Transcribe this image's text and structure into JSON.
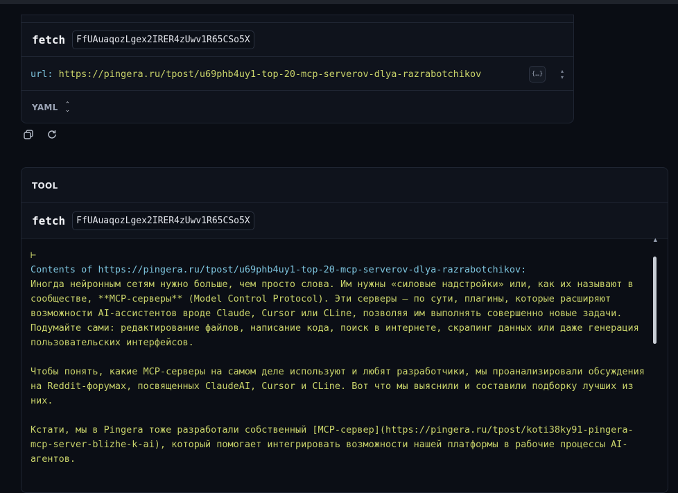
{
  "call": {
    "tool_name": "fetch",
    "call_id": "FfUAuaqozLgex2IRER4zUwv1R65CSo5X",
    "arg_key": "url:",
    "arg_value": "https://pingera.ru/tpost/u69phb4uy1-top-20-mcp-serverov-dlya-razrabotchikov",
    "format_label": "YAML",
    "json_icon": "{…}"
  },
  "actions": {
    "copy_icon": "copy-icon",
    "retry_icon": "refresh-icon"
  },
  "tool_result": {
    "section_title": "TOOL",
    "tool_name": "fetch",
    "call_id": "FfUAuaqozLgex2IRER4zUwv1R65CSo5X",
    "marker": "⊢",
    "header": "Contents of https://pingera.ru/tpost/u69phb4uy1-top-20-mcp-serverov-dlya-razrabotchikov:",
    "body": "Иногда нейронным сетям нужно больше, чем просто слова. Им нужны «силовые надстройки» или, как их называют в сообществе, **MCP-серверы** (Model Control Protocol). Эти серверы — по сути, плагины, которые расширяют возможности AI-ассистентов вроде Claude, Cursor или CLine, позволяя им выполнять совершенно новые задачи. Подумайте сами: редактирование файлов, написание кода, поиск в интернете, скрапинг данных или даже генерация пользовательских интерфейсов.\n\nЧтобы понять, какие MCP-серверы на самом деле используют и любят разработчики, мы проанализировали обсуждения на Reddit-форумах, посвященных ClaudeAI, Cursor и CLine. Вот что мы выяснили и составили подборку лучших из них.\n\nКстати, мы в Pingera тоже разработали собственный [MCP-сервер](https://pingera.ru/tpost/koti38ky91-pingera-mcp-server-blizhe-k-ai), который помогает интегрировать возможности нашей платформы в рабочие процессы AI-агентов."
  },
  "colors": {
    "background": "#0a0d14",
    "card": "#0f131c",
    "key": "#7dc4de",
    "value": "#c9d36a"
  }
}
